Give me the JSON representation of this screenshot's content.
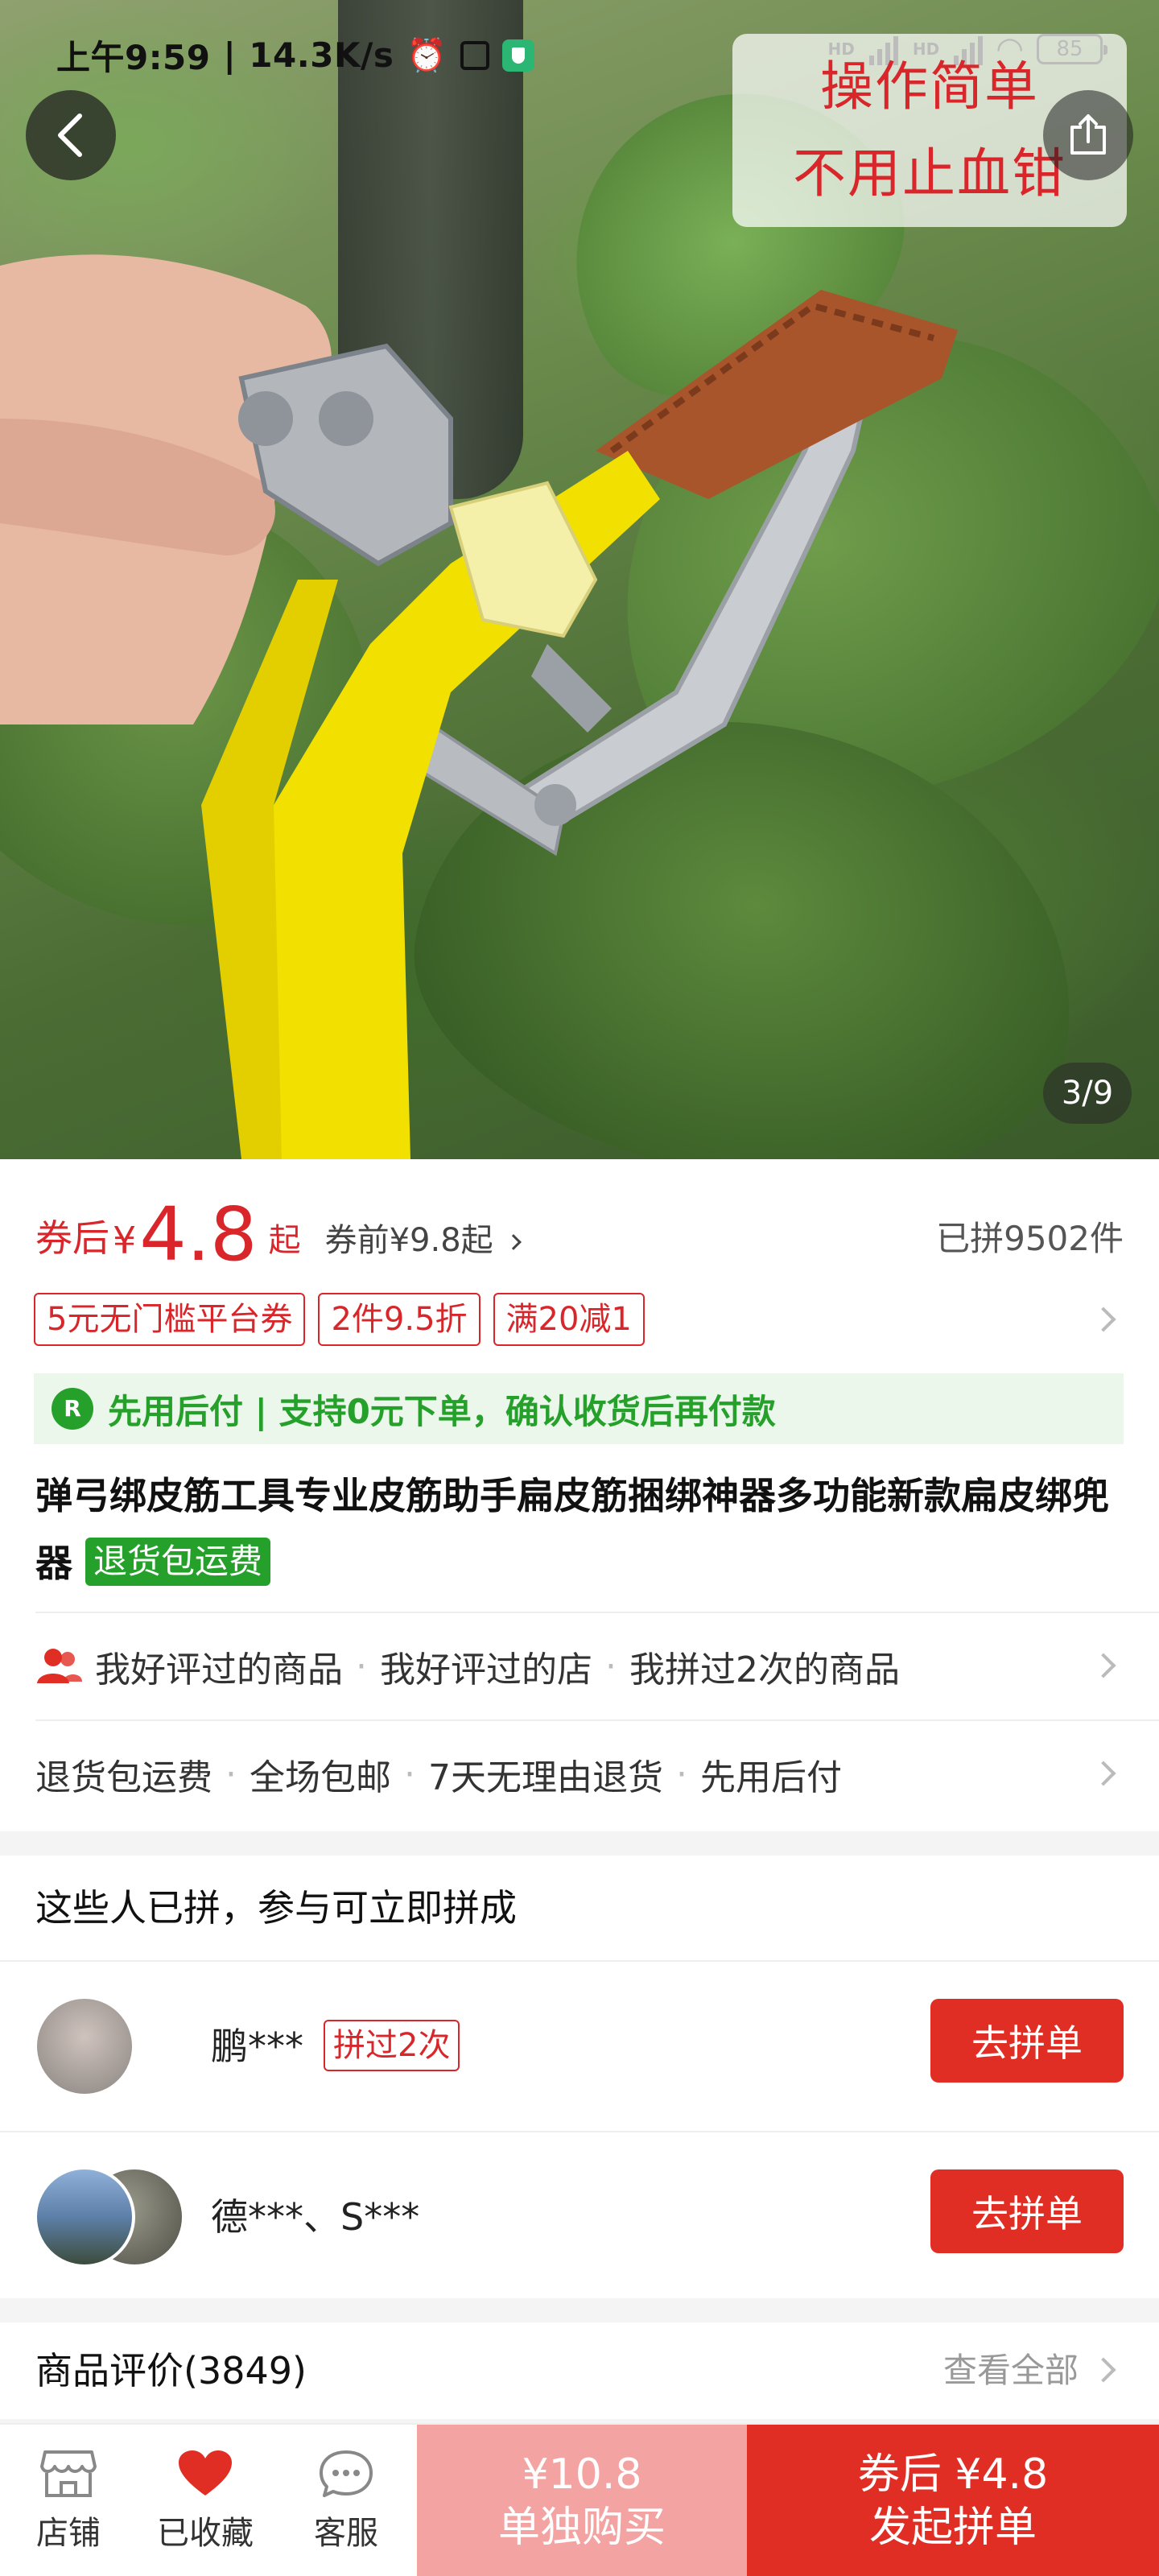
{
  "status_bar": {
    "time": "上午9:59",
    "speed": "14.3K/s",
    "network_1": "HD",
    "network_2": "HD",
    "battery": "85"
  },
  "hero": {
    "overlay_line1": "操作简单",
    "overlay_line2": "不用止血钳",
    "image_counter": "3/9"
  },
  "price": {
    "after_coupon_label": "券后",
    "currency": "¥",
    "amount": "4.8",
    "suffix": "起",
    "before_coupon": "券前¥9.8起",
    "sold": "已拼9502件"
  },
  "promo_tags": [
    "5元无门槛平台券",
    "2件9.5折",
    "满20减1"
  ],
  "pay_later": "先用后付 | 支持0元下单，确认收货后再付款",
  "product": {
    "title": "弹弓绑皮筋工具专业皮筋助手扁皮筋捆绑神器多功能新款扁皮绑兜器",
    "badge": "退货包运费"
  },
  "social_row": [
    "我好评过的商品",
    "我好评过的店",
    "我拼过2次的商品"
  ],
  "service_row": [
    "退货包运费",
    "全场包邮",
    "7天无理由退货",
    "先用后付"
  ],
  "group_buy": {
    "title": "这些人已拼，参与可立即拼成",
    "rows": [
      {
        "name": "鹏***",
        "badge": "拼过2次",
        "action": "去拼单"
      },
      {
        "name": "德***、S***",
        "action": "去拼单"
      }
    ]
  },
  "reviews": {
    "title": "商品评价(3849)",
    "view_all": "查看全部"
  },
  "bottom_bar": {
    "store": "店铺",
    "favorited": "已收藏",
    "service": "客服",
    "single_price": "¥10.8",
    "single_label": "单独购买",
    "group_price": "券后 ¥4.8",
    "group_label": "发起拼单"
  },
  "colors": {
    "accent": "#e02e24",
    "price_red": "#d8262b",
    "green": "#25a12b",
    "single_buy_bg": "#f3a4a2"
  }
}
